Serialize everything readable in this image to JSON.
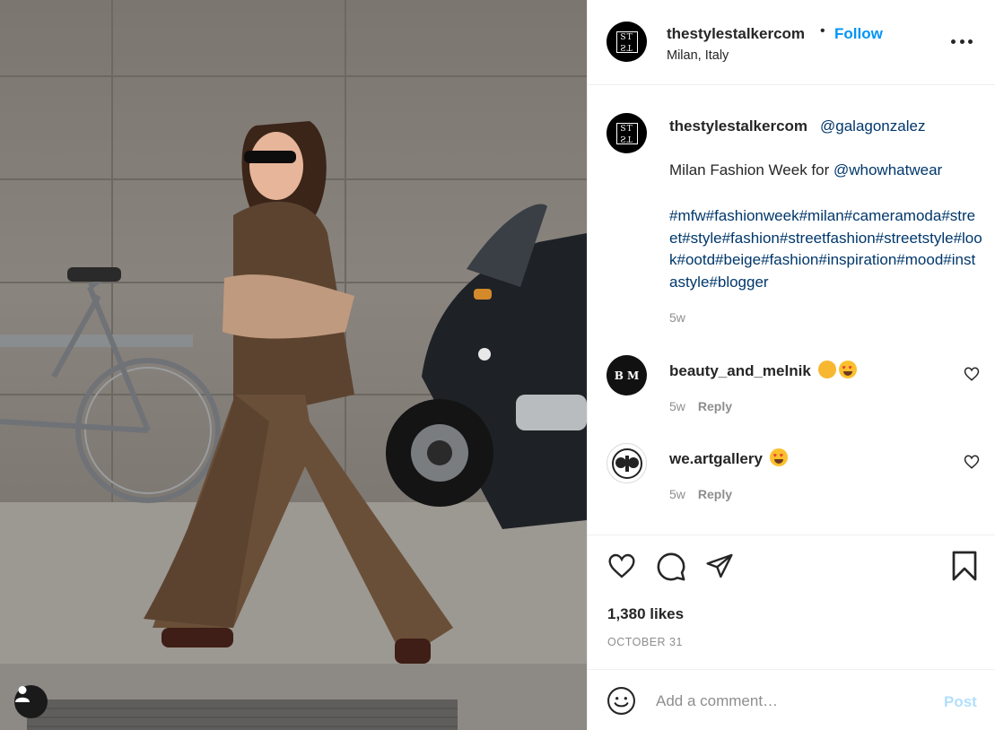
{
  "post": {
    "image_alt": "photo",
    "tag_icon": "user-tag-icon"
  },
  "header": {
    "username": "thestylestalkercom",
    "separator": "•",
    "follow_label": "Follow",
    "location": "Milan, Italy",
    "avatar_logo_top": "ST",
    "avatar_logo_bottom": "ST",
    "more_icon": "more-options-icon"
  },
  "caption": {
    "username": "thestylestalkercom",
    "mention": "@galagonzalez",
    "text_prefix": "Milan Fashion Week for ",
    "text_mention": "@whowhatwear",
    "hashtags": "#mfw#fashionweek#milan#cameramoda#street#style#fashion#streetfashion#streetstyle#look#ootd#beige#fashion#inspiration#mood#instastyle#blogger",
    "time": "5w"
  },
  "comments": [
    {
      "username": "beauty_and_melnik",
      "emoji": [
        "clapping-hands",
        "heart-eyes"
      ],
      "time": "5w",
      "reply_label": "Reply",
      "avatar_text": "B M"
    },
    {
      "username": "we.artgallery",
      "emoji": [
        "heart-eyes"
      ],
      "time": "5w",
      "reply_label": "Reply"
    }
  ],
  "actions": {
    "like_icon": "heart-icon",
    "comment_icon": "comment-icon",
    "share_icon": "share-icon",
    "save_icon": "bookmark-icon",
    "likes": "1,380 likes",
    "date": "OCTOBER 31"
  },
  "add_comment": {
    "placeholder": "Add a comment…",
    "post_label": "Post",
    "emoji_icon": "smiley-icon"
  },
  "colors": {
    "link": "#0095f6",
    "mention": "#00376b",
    "muted": "#8e8e8e",
    "text": "#262626",
    "post_disabled": "#b2dffc"
  }
}
